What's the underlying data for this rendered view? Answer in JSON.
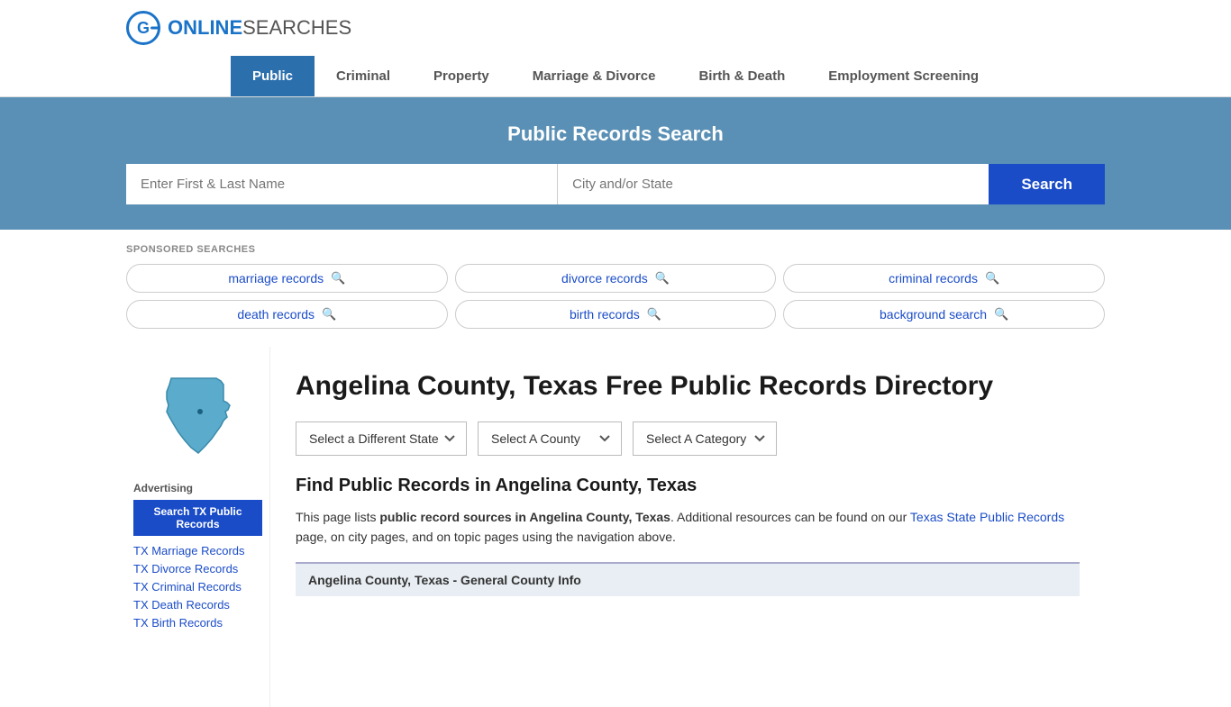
{
  "header": {
    "logo_online": "ONLINE",
    "logo_searches": "SEARCHES"
  },
  "nav": {
    "items": [
      {
        "label": "Public",
        "active": true
      },
      {
        "label": "Criminal",
        "active": false
      },
      {
        "label": "Property",
        "active": false
      },
      {
        "label": "Marriage & Divorce",
        "active": false
      },
      {
        "label": "Birth & Death",
        "active": false
      },
      {
        "label": "Employment Screening",
        "active": false
      }
    ]
  },
  "hero": {
    "title": "Public Records Search",
    "name_placeholder": "Enter First & Last Name",
    "location_placeholder": "City and/or State",
    "search_button": "Search"
  },
  "sponsored": {
    "label": "SPONSORED SEARCHES",
    "items": [
      "marriage records",
      "divorce records",
      "criminal records",
      "death records",
      "birth records",
      "background search"
    ]
  },
  "sidebar": {
    "advertising_label": "Advertising",
    "search_btn": "Search TX Public Records",
    "links": [
      "TX Marriage Records",
      "TX Divorce Records",
      "TX Criminal Records",
      "TX Death Records",
      "TX Birth Records"
    ]
  },
  "content": {
    "page_title": "Angelina County, Texas Free Public Records Directory",
    "dropdowns": {
      "state": "Select a Different State",
      "county": "Select A County",
      "category": "Select A Category"
    },
    "find_title": "Find Public Records in Angelina County, Texas",
    "find_text_1": "This page lists ",
    "find_text_bold": "public record sources in Angelina County, Texas",
    "find_text_2": ". Additional resources can be found on our ",
    "find_link": "Texas State Public Records",
    "find_text_3": " page, on city pages, and on topic pages using the navigation above.",
    "county_info_bar": "Angelina County, Texas - General County Info"
  }
}
